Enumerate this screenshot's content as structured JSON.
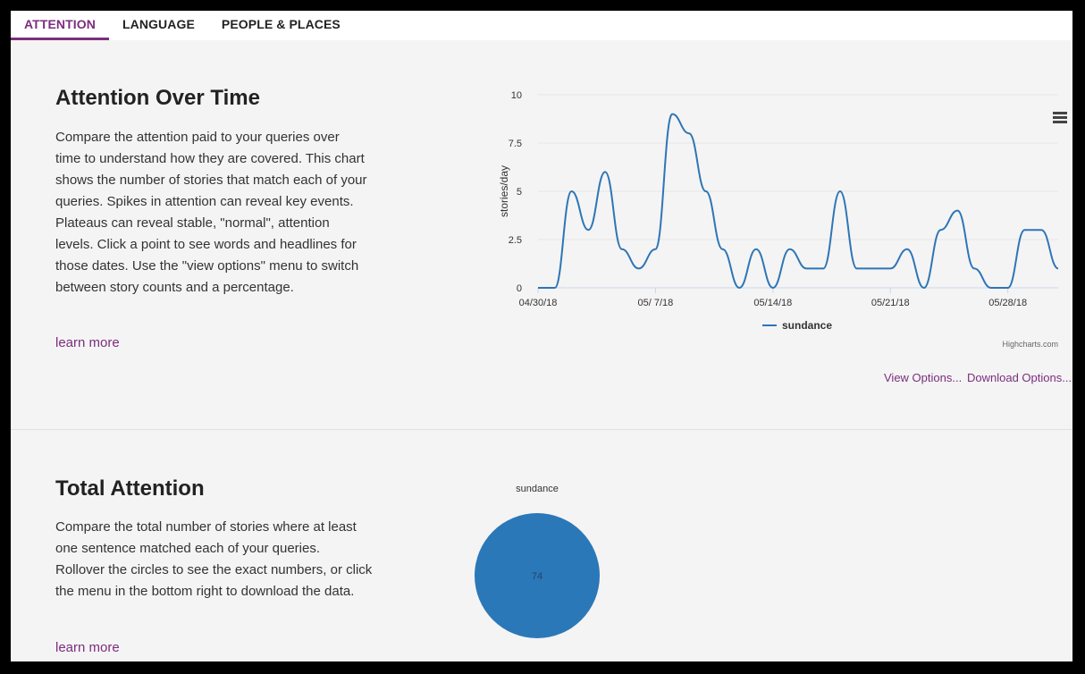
{
  "tabs": [
    {
      "label": "ATTENTION",
      "active": true
    },
    {
      "label": "LANGUAGE",
      "active": false
    },
    {
      "label": "PEOPLE & PLACES",
      "active": false
    }
  ],
  "attention_over_time": {
    "title": "Attention Over Time",
    "description": "Compare the attention paid to your queries over time to understand how they are covered. This chart shows the number of stories that match each of your queries. Spikes in attention can reveal key events. Plateaus can reveal stable, \"normal\", attention levels. Click a point to see words and headlines for those dates. Use the \"view options\" menu to switch between story counts and a percentage.",
    "learn_more": "learn more",
    "view_options": "View Options...",
    "download_options": "Download Options...",
    "credits": "Highcharts.com",
    "menu_icon": "hamburger-menu-icon"
  },
  "total_attention": {
    "title": "Total Attention",
    "description": "Compare the total number of stories where at least one sentence matched each of your queries. Rollover the circles to see the exact numbers, or click the menu in the bottom right to download the data.",
    "learn_more": "learn more"
  },
  "colors": {
    "accent": "#7b2d7e",
    "series": "#2e75b6",
    "bubble": "#2b78b8"
  },
  "chart_data": [
    {
      "type": "line",
      "title": "",
      "ylabel": "stories/day",
      "xlabel": "",
      "ylim": [
        0,
        10
      ],
      "yticks": [
        "0",
        "2.5",
        "5",
        "7.5",
        "10"
      ],
      "xticks": [
        {
          "day": 0,
          "label": "04/30/18"
        },
        {
          "day": 7,
          "label": "05/ 7/18"
        },
        {
          "day": 14,
          "label": "05/14/18"
        },
        {
          "day": 21,
          "label": "05/21/18"
        },
        {
          "day": 28,
          "label": "05/28/18"
        }
      ],
      "legend": "bottom-center",
      "grid": true,
      "series": [
        {
          "name": "sundance",
          "dates": [
            "04/30/18",
            "05/01/18",
            "05/02/18",
            "05/03/18",
            "05/04/18",
            "05/05/18",
            "05/06/18",
            "05/07/18",
            "05/08/18",
            "05/09/18",
            "05/10/18",
            "05/11/18",
            "05/12/18",
            "05/13/18",
            "05/14/18",
            "05/15/18",
            "05/16/18",
            "05/17/18",
            "05/18/18",
            "05/19/18",
            "05/20/18",
            "05/21/18",
            "05/22/18",
            "05/23/18",
            "05/24/18",
            "05/25/18",
            "05/26/18",
            "05/27/18",
            "05/28/18",
            "05/29/18",
            "05/30/18",
            "05/31/18"
          ],
          "values": [
            0,
            0,
            5,
            3,
            6,
            2,
            1,
            2,
            9,
            8,
            5,
            2,
            0,
            2,
            0,
            2,
            1,
            1,
            5,
            1,
            1,
            1,
            2,
            0,
            3,
            4,
            1,
            0,
            0,
            3,
            3,
            1
          ]
        }
      ]
    },
    {
      "type": "bubble",
      "title": "",
      "series": [
        {
          "name": "sundance",
          "value": 74
        }
      ]
    }
  ]
}
